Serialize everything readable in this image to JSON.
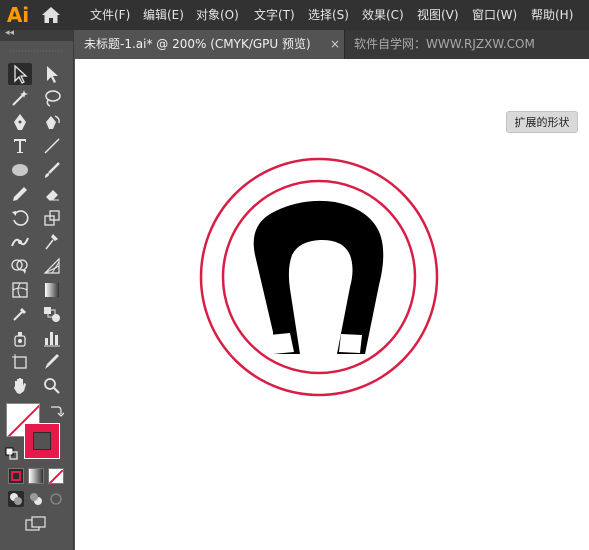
{
  "app": {
    "logo_text": "Ai",
    "brand_color": "#ff9a00"
  },
  "menu": {
    "items": [
      {
        "label": "文件(F)"
      },
      {
        "label": "编辑(E)"
      },
      {
        "label": "对象(O)"
      },
      {
        "label": "文字(T)"
      },
      {
        "label": "选择(S)"
      },
      {
        "label": "效果(C)"
      },
      {
        "label": "视图(V)"
      },
      {
        "label": "窗口(W)"
      },
      {
        "label": "帮助(H)"
      }
    ]
  },
  "tabs": {
    "active_label": "未标题-1.ai* @ 200% (CMYK/GPU 预览)",
    "close_glyph": "×",
    "watermark_text": "软件自学网：WWW.RJZXW.COM"
  },
  "toolbar": {
    "collapse_glyph": "◂◂",
    "tools": [
      {
        "icon": "selection-tool-icon"
      },
      {
        "icon": "direct-selection-tool-icon"
      },
      {
        "icon": "magic-wand-tool-icon"
      },
      {
        "icon": "lasso-tool-icon"
      },
      {
        "icon": "pen-tool-icon"
      },
      {
        "icon": "curvature-tool-icon"
      },
      {
        "icon": "type-tool-icon"
      },
      {
        "icon": "line-segment-tool-icon"
      },
      {
        "icon": "ellipse-tool-icon"
      },
      {
        "icon": "paintbrush-tool-icon"
      },
      {
        "icon": "pencil-tool-icon"
      },
      {
        "icon": "eraser-tool-icon"
      },
      {
        "icon": "rotate-tool-icon"
      },
      {
        "icon": "scale-tool-icon"
      },
      {
        "icon": "width-tool-icon"
      },
      {
        "icon": "puppet-warp-tool-icon"
      },
      {
        "icon": "shape-builder-tool-icon"
      },
      {
        "icon": "perspective-grid-tool-icon"
      },
      {
        "icon": "mesh-tool-icon"
      },
      {
        "icon": "gradient-tool-icon"
      },
      {
        "icon": "eyedropper-tool-icon"
      },
      {
        "icon": "blend-tool-icon"
      },
      {
        "icon": "symbol-sprayer-tool-icon"
      },
      {
        "icon": "column-graph-tool-icon"
      },
      {
        "icon": "artboard-tool-icon"
      },
      {
        "icon": "slice-tool-icon"
      },
      {
        "icon": "hand-tool-icon"
      },
      {
        "icon": "zoom-tool-icon"
      }
    ],
    "fill_color": "none",
    "stroke_color": "#e8194a"
  },
  "canvas": {
    "expand_button_label": "扩展的形状",
    "ring_color": "#d81e45",
    "shape_color": "#000000"
  }
}
